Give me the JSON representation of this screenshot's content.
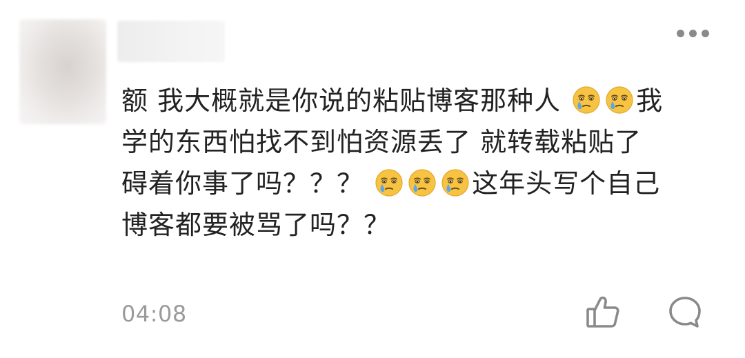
{
  "comment": {
    "lines": [
      [
        {
          "t": "text",
          "v": "额 我大概就是你说的粘贴博客那种人 "
        },
        {
          "t": "emoji",
          "v": "crying-emoji"
        },
        {
          "t": "emoji",
          "v": "crying-emoji"
        },
        {
          "t": "text",
          "v": "我"
        }
      ],
      [
        {
          "t": "text",
          "v": "学的东西怕找不到怕资源丢了 就转载粘贴了"
        }
      ],
      [
        {
          "t": "text",
          "v": "碍着你事了吗？？？ "
        },
        {
          "t": "emoji",
          "v": "crying-emoji"
        },
        {
          "t": "emoji",
          "v": "crying-emoji"
        },
        {
          "t": "emoji",
          "v": "crying-emoji"
        },
        {
          "t": "text",
          "v": "这年头写个自己"
        }
      ],
      [
        {
          "t": "text",
          "v": "博客都要被骂了吗？？"
        }
      ]
    ],
    "timestamp": "04:08"
  },
  "icons": {
    "more": "more-dots-icon",
    "like": "thumbs-up-icon",
    "reply": "comment-bubble-icon",
    "emoji": "crying-emoji"
  },
  "colors": {
    "text": "#222222",
    "meta": "#9a9a9a",
    "icon": "#8a8a8a",
    "emoji_face": "#f7c342",
    "tear": "#5aa7e8"
  }
}
